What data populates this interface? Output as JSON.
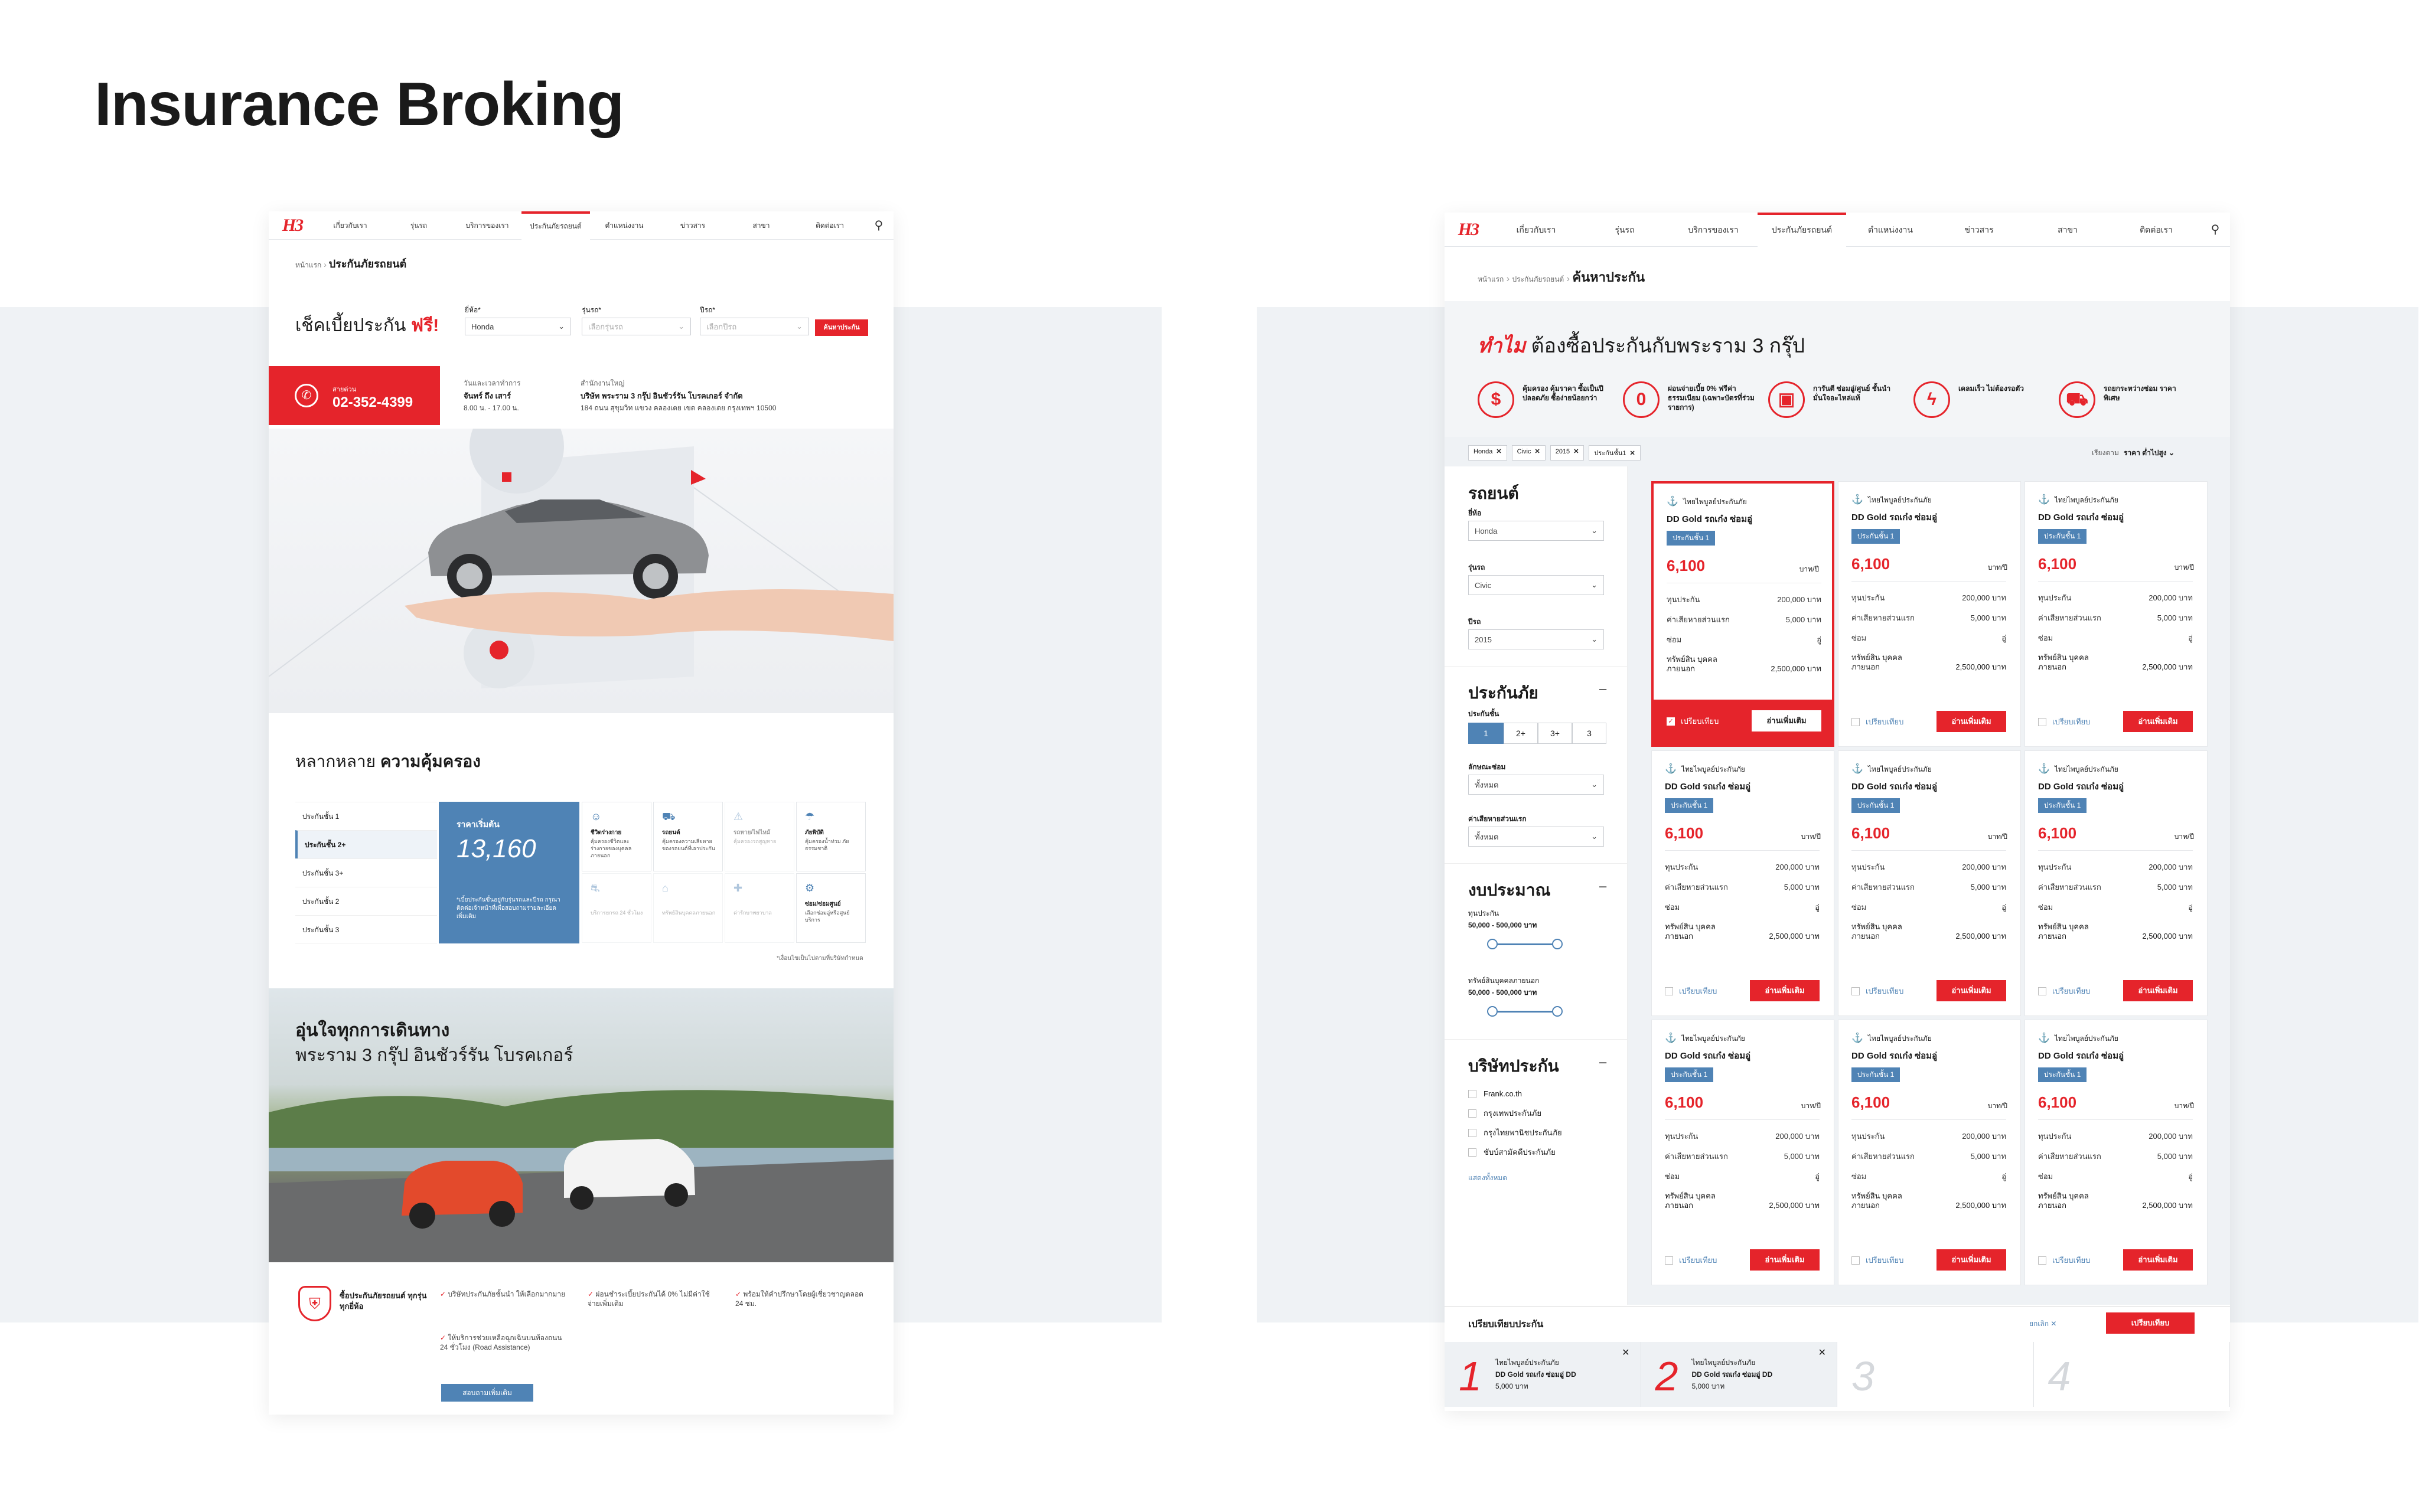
{
  "page_title": "Insurance Broking",
  "colors": {
    "accent": "#e5242b",
    "blue": "#4f83b5",
    "band": "#eff2f5"
  },
  "left": {
    "logo": "H3",
    "nav": [
      "เกี่ยวกับเรา",
      "รุ่นรถ",
      "บริการของเรา",
      "ประกันภัยรถยนต์",
      "ตำแหน่งงาน",
      "ข่าวสาร",
      "สาขา",
      "ติดต่อเรา"
    ],
    "breadcrumb_home": "หน้าแรก",
    "breadcrumb_current": "ประกันภัยรถยนต์",
    "check_title": "เช็คเบี้ยประกัน",
    "check_title_free": "ฟรี!",
    "brand_label": "ยี่ห้อ*",
    "brand_value": "Honda",
    "model_label": "รุ่นรถ*",
    "model_placeholder": "เลือกรุ่นรถ",
    "year_label": "ปีรถ*",
    "year_placeholder": "เลือกปีรถ",
    "search_button": "ค้นหาประกัน",
    "hotline_label": "สายด่วน",
    "hotline_number": "02-352-4399",
    "hours_label": "วันและเวลาทำการ",
    "hours_days": "จันทร์ ถึง เสาร์",
    "hours_time": "8.00 น. - 17.00 น.",
    "company_label": "สำนักงานใหญ่",
    "company_name": "บริษัท พระราม 3 กรุ๊ป อินชัวร์รัน โบรคเกอร์ จำกัด",
    "company_address": "184 ถนน สุขุมวิท แขวง คลองเตย เขต คลองเตย กรุงเทพฯ 10500",
    "coverage_title_a": "หลากหลาย",
    "coverage_title_b": "ความคุ้มครอง",
    "classes": [
      "ประกันชั้น 1",
      "ประกันชั้น 2+",
      "ประกันชั้น 3+",
      "ประกันชั้น 2",
      "ประกันชั้น 3"
    ],
    "price_label": "ราคาเริ่มต้น",
    "price_value": "13,160",
    "price_note": "*เบี้ยประกันขึ้นอยู่กับรุ่นรถและปีรถ กรุณาติดต่อเจ้าหน้าที่เพื่อสอบถามรายละเอียดเพิ่มเติม",
    "features": [
      {
        "icon": "person-icon",
        "title": "ชีวิตร่างกาย",
        "desc": "คุ้มครองชีวิตและร่างกายของบุคคลภายนอก"
      },
      {
        "icon": "car-icon",
        "title": "รถยนต์",
        "desc": "คุ้มครองความเสียหายของรถยนต์ที่เอาประกัน"
      },
      {
        "icon": "car-crash-icon",
        "title": "รถหาย/ไฟไหม้",
        "desc": "คุ้มครองรถสูญหาย"
      },
      {
        "icon": "water-icon",
        "title": "ภัยพิบัติ",
        "desc": "คุ้มครองน้ำท่วม ภัยธรรมชาติ"
      },
      {
        "icon": "tow-icon",
        "title": "",
        "desc": "บริการยกรถ 24 ชั่วโมง"
      },
      {
        "icon": "property-icon",
        "title": "",
        "desc": "ทรัพย์สินบุคคลภายนอก"
      },
      {
        "icon": "medical-icon",
        "title": "",
        "desc": "ค่ารักษาพยาบาล"
      },
      {
        "icon": "repair-icon",
        "title": "ซ่อม/ซ่อมศูนย์",
        "desc": "เลือกซ่อมอู่หรือศูนย์บริการ"
      }
    ],
    "features_note": "*เงื่อนไขเป็นไปตามที่บริษัทกำหนด",
    "banner_line1": "อุ่นใจทุกการเดินทาง",
    "banner_line2": "พระราม 3 กรุ๊ป อินชัวร์รัน โบรคเกอร์",
    "why_title": "ซื้อประกันภัยรถยนต์ ทุกรุ่น ทุกยี่ห้อ",
    "benefits": [
      "บริษัทประกันภัยชั้นนำ ให้เลือกมากมาย",
      "ผ่อนชำระเบี้ยประกันได้ 0% ไม่มีค่าใช้จ่ายเพิ่มเติม",
      "พร้อมให้คำปรึกษาโดยผู้เชี่ยวชาญตลอด 24 ชม.",
      "ให้บริการช่วยเหลือฉุกเฉินบนท้องถนน 24 ชั่วโมง (Road Assistance)"
    ],
    "more_button": "สอบถามเพิ่มเติม"
  },
  "right": {
    "nav": [
      "เกี่ยวกับเรา",
      "รุ่นรถ",
      "บริการของเรา",
      "ประกันภัยรถยนต์",
      "ตำแหน่งงาน",
      "ข่าวสาร",
      "สาขา",
      "ติดต่อเรา"
    ],
    "breadcrumb_home": "หน้าแรก",
    "breadcrumb_mid": "ประกันภัยรถยนต์",
    "breadcrumb_current": "ค้นหาประกัน",
    "why_a": "ทำไม",
    "why_b": "ต้องซื้อประกันกับพระราม 3 กรุ๊ป",
    "reasons": [
      {
        "icon": "shield-money-icon",
        "text": "คุ้มครอง คุ้มราคา ซื้อเป็นปีปลอดภัย ซื้อง่ายน้อยกว่า"
      },
      {
        "icon": "zero-percent-icon",
        "text": "ผ่อนจ่ายเบี้ย 0% ฟรีค่าธรรมเนียม (เฉพาะบัตรที่ร่วมรายการ)"
      },
      {
        "icon": "box-icon",
        "text": "การันตี ซ่อมอู่/ศูนย์ ชั้นนำ มั่นใจอะไหล่แท้"
      },
      {
        "icon": "flash-icon",
        "text": "เคลมเร็ว ไม่ต้องรอตัว"
      },
      {
        "icon": "tow-truck-icon",
        "text": "รถยกระหว่างซ่อม ราคาพิเศษ"
      }
    ],
    "chips": [
      "Honda",
      "Civic",
      "2015",
      "ประกันชั้น1"
    ],
    "sort_label": "เรียงตาม",
    "sort_value": "ราคา ต่ำไปสูง",
    "filter_car_title": "รถยนต์",
    "filter_brand_label": "ยี่ห้อ",
    "filter_brand": "Honda",
    "filter_model_label": "รุ่นรถ",
    "filter_model": "Civic",
    "filter_year_label": "ปีรถ",
    "filter_year": "2015",
    "filter_ins_title": "ประกันภัย",
    "filter_class_label": "ประกันชั้น",
    "filter_classes": [
      "1",
      "2+",
      "3+",
      "3"
    ],
    "filter_repair_label": "ลักษณะซ่อม",
    "filter_repair": "ทั้งหมด",
    "filter_deduct_label": "ค่าเสียหายส่วนแรก",
    "filter_deduct": "ทั้งหมด",
    "filter_budget_title": "งบประมาณ",
    "budget1_label": "ทุนประกัน",
    "budget1_range": "50,000 - 500,000 บาท",
    "budget2_label": "ทรัพย์สินบุคคลภายนอก",
    "budget2_range": "50,000 - 500,000 บาท",
    "filter_company_title": "บริษัทประกัน",
    "companies": [
      "Frank.co.th",
      "กรุงเทพประกันภัย",
      "กรุงไทยพานิชประกันภัย",
      "ชับบ์สามัคคีประกันภัย"
    ],
    "show_all": "แสดงทั้งหมด",
    "card": {
      "company": "ไทยไพบูลย์ประกันภัย",
      "plan": "DD Gold รถเก๋ง ซ่อมอู่",
      "class_tag": "ประกันชั้น 1",
      "price": "6,100",
      "price_unit": "บาท/ปี",
      "sum_label": "ทุนประกัน",
      "sum_value": "200,000",
      "deduct_label": "ค่าเสียหายส่วนแรก",
      "deduct_value": "5,000",
      "repair_label": "ซ่อม",
      "repair_value": "อู่",
      "prop_label": "ทรัพย์สิน บุคคลภายนอก",
      "prop_value": "2,500,000",
      "baht": "บาท",
      "compare_label": "เปรียบเทียบ",
      "more_button": "อ่านเพิ่มเติม"
    },
    "compare_bar_title": "เปรียบเทียบประกัน",
    "compare_cancel": "ยกเลิก",
    "compare_button": "เปรียบเทียบ",
    "compare_slots": [
      {
        "num": "1",
        "company": "ไทยไพบูลย์ประกันภัย",
        "plan": "DD Gold รถเก๋ง ซ่อมอู่ DD",
        "price": "5,000 บาท"
      },
      {
        "num": "2",
        "company": "ไทยไพบูลย์ประกันภัย",
        "plan": "DD Gold รถเก๋ง ซ่อมอู่ DD",
        "price": "5,000 บาท"
      },
      {
        "num": "3"
      },
      {
        "num": "4"
      }
    ]
  }
}
